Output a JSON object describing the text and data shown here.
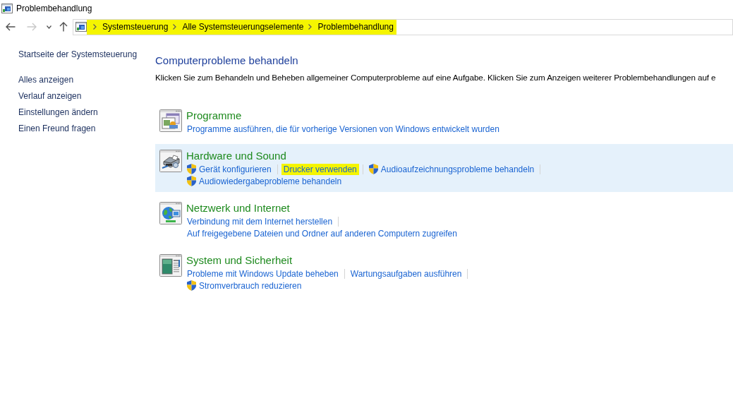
{
  "window": {
    "title": "Problembehandlung"
  },
  "navigation": [
    {
      "kind": "back",
      "disabled": false
    },
    {
      "kind": "forward",
      "disabled": true
    },
    {
      "kind": "history",
      "disabled": false
    },
    {
      "kind": "up",
      "disabled": false
    }
  ],
  "address_bar": {
    "highlighted": true,
    "breadcrumb": [
      {
        "label": "Systemsteuerung"
      },
      {
        "label": "Alle Systemsteuerungselemente"
      },
      {
        "label": "Problembehandlung"
      }
    ]
  },
  "sidebar": {
    "home": "Startseite der Systemsteuerung",
    "links": [
      "Alles anzeigen",
      "Verlauf anzeigen",
      "Einstellungen ändern",
      "Einen Freund fragen"
    ]
  },
  "main": {
    "heading": "Computerprobleme behandeln",
    "description": "Klicken Sie zum Behandeln und Beheben allgemeiner Computerprobleme auf eine Aufgabe. Klicken Sie zum Anzeigen weiterer Problembehandlungen auf e"
  },
  "categories": [
    {
      "title": "Programme",
      "selected": false,
      "task_lines": [
        [
          {
            "label": "Programme ausführen, die für vorherige Versionen von Windows entwickelt wurden",
            "shield": false,
            "highlighted": false
          }
        ]
      ]
    },
    {
      "title": "Hardware und Sound",
      "selected": true,
      "task_lines": [
        [
          {
            "label": "Gerät konfigurieren",
            "shield": true,
            "highlighted": false
          },
          {
            "label": "Drucker verwenden",
            "shield": false,
            "highlighted": true
          },
          {
            "label": "Audioaufzeichnungsprobleme behandeln",
            "shield": true,
            "highlighted": false
          }
        ],
        [
          {
            "label": "Audiowiedergabeprobleme behandeln",
            "shield": true,
            "highlighted": false
          }
        ]
      ]
    },
    {
      "title": "Netzwerk und Internet",
      "selected": false,
      "task_lines": [
        [
          {
            "label": "Verbindung mit dem Internet herstellen",
            "shield": false,
            "highlighted": false
          }
        ],
        [
          {
            "label": "Auf freigegebene Dateien und Ordner auf anderen Computern zugreifen",
            "shield": false,
            "highlighted": false
          }
        ]
      ]
    },
    {
      "title": "System und Sicherheit",
      "selected": false,
      "task_lines": [
        [
          {
            "label": "Probleme mit Windows Update beheben",
            "shield": false,
            "highlighted": false
          },
          {
            "label": "Wartungsaufgaben ausführen",
            "shield": false,
            "highlighted": false
          }
        ],
        [
          {
            "label": "Stromverbrauch reduzieren",
            "shield": true,
            "highlighted": false
          }
        ]
      ]
    }
  ]
}
